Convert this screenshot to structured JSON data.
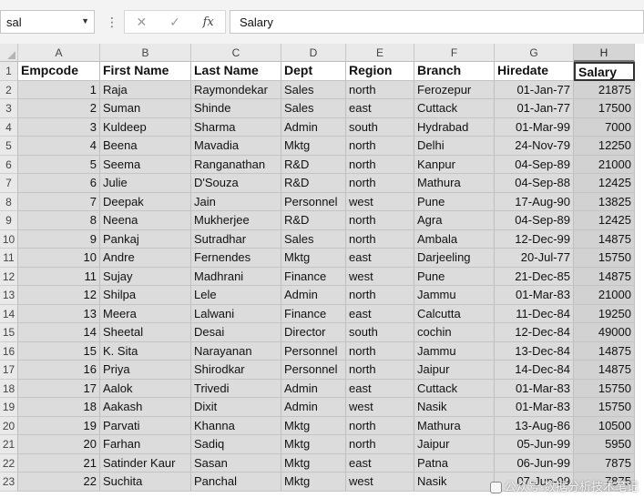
{
  "formula_bar": {
    "name_box": "sal",
    "fx_label": "fx",
    "content": "Salary"
  },
  "columns": [
    "A",
    "B",
    "C",
    "D",
    "E",
    "F",
    "G",
    "H"
  ],
  "selected_column": "H",
  "headers": [
    "Empcode",
    "First Name",
    "Last Name",
    "Dept",
    "Region",
    "Branch",
    "Hiredate",
    "Salary"
  ],
  "rows": [
    [
      "1",
      "Raja",
      "Raymondekar",
      "Sales",
      "north",
      "Ferozepur",
      "01-Jan-77",
      "21875"
    ],
    [
      "2",
      "Suman",
      "Shinde",
      "Sales",
      "east",
      "Cuttack",
      "01-Jan-77",
      "17500"
    ],
    [
      "3",
      "Kuldeep",
      "Sharma",
      "Admin",
      "south",
      "Hydrabad",
      "01-Mar-99",
      "7000"
    ],
    [
      "4",
      "Beena",
      "Mavadia",
      "Mktg",
      "north",
      "Delhi",
      "24-Nov-79",
      "12250"
    ],
    [
      "5",
      "Seema",
      "Ranganathan",
      "R&D",
      "north",
      "Kanpur",
      "04-Sep-89",
      "21000"
    ],
    [
      "6",
      "Julie",
      "D'Souza",
      "R&D",
      "north",
      "Mathura",
      "04-Sep-88",
      "12425"
    ],
    [
      "7",
      "Deepak",
      "Jain",
      "Personnel",
      "west",
      "Pune",
      "17-Aug-90",
      "13825"
    ],
    [
      "8",
      "Neena",
      "Mukherjee",
      "R&D",
      "north",
      "Agra",
      "04-Sep-89",
      "12425"
    ],
    [
      "9",
      "Pankaj",
      "Sutradhar",
      "Sales",
      "north",
      "Ambala",
      "12-Dec-99",
      "14875"
    ],
    [
      "10",
      "Andre",
      "Fernendes",
      "Mktg",
      "east",
      "Darjeeling",
      "20-Jul-77",
      "15750"
    ],
    [
      "11",
      "Sujay",
      "Madhrani",
      "Finance",
      "west",
      "Pune",
      "21-Dec-85",
      "14875"
    ],
    [
      "12",
      "Shilpa",
      "Lele",
      "Admin",
      "north",
      "Jammu",
      "01-Mar-83",
      "21000"
    ],
    [
      "13",
      "Meera",
      "Lalwani",
      "Finance",
      "east",
      "Calcutta",
      "11-Dec-84",
      "19250"
    ],
    [
      "14",
      "Sheetal",
      "Desai",
      "Director",
      "south",
      "cochin",
      "12-Dec-84",
      "49000"
    ],
    [
      "15",
      "K. Sita",
      "Narayanan",
      "Personnel",
      "north",
      "Jammu",
      "13-Dec-84",
      "14875"
    ],
    [
      "16",
      "Priya",
      "Shirodkar",
      "Personnel",
      "north",
      "Jaipur",
      "14-Dec-84",
      "14875"
    ],
    [
      "17",
      "Aalok",
      "Trivedi",
      "Admin",
      "east",
      "Cuttack",
      "01-Mar-83",
      "15750"
    ],
    [
      "18",
      "Aakash",
      "Dixit",
      "Admin",
      "west",
      "Nasik",
      "01-Mar-83",
      "15750"
    ],
    [
      "19",
      "Parvati",
      "Khanna",
      "Mktg",
      "north",
      "Mathura",
      "13-Aug-86",
      "10500"
    ],
    [
      "20",
      "Farhan",
      "Sadiq",
      "Mktg",
      "north",
      "Jaipur",
      "05-Jun-99",
      "5950"
    ],
    [
      "21",
      "Satinder Kaur",
      "Sasan",
      "Mktg",
      "east",
      "Patna",
      "06-Jun-99",
      "7875"
    ],
    [
      "22",
      "Suchita",
      "Panchal",
      "Mktg",
      "west",
      "Nasik",
      "07-Jun-99",
      "7875"
    ]
  ],
  "watermark": "公众号·数据分析技术笔记",
  "colors": {
    "selected_header_border": "#333333",
    "cell_background": "#dcdcdc"
  }
}
